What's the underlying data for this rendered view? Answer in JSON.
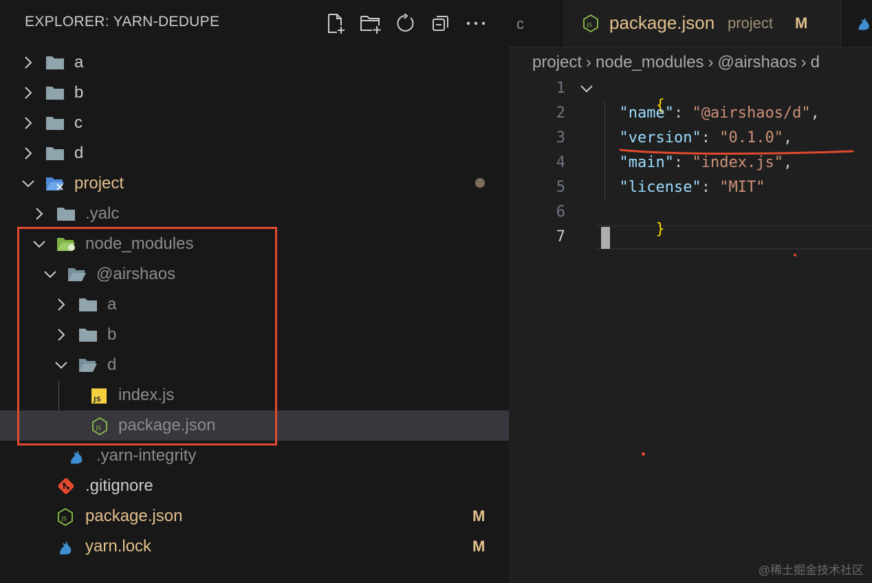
{
  "sidebar": {
    "title": "EXPLORER: YARN-DEDUPE",
    "actions": [
      {
        "icon": "new-file-icon"
      },
      {
        "icon": "new-folder-icon"
      },
      {
        "icon": "refresh-icon"
      },
      {
        "icon": "collapse-all-icon"
      },
      {
        "icon": "more-actions-icon"
      }
    ],
    "tree": {
      "a": "a",
      "b": "b",
      "c": "c",
      "d": "d",
      "project": "project",
      "yalc": ".yalc",
      "node_modules": "node_modules",
      "airshaos": "@airshaos",
      "nm_a": "a",
      "nm_b": "b",
      "nm_d": "d",
      "index_js": "index.js",
      "nm_package_json": "package.json",
      "yarn_integrity": ".yarn-integrity",
      "gitignore": ".gitignore",
      "package_json": "package.json",
      "package_json_badge": "M",
      "yarn_lock": "yarn.lock",
      "yarn_lock_badge": "M"
    }
  },
  "editor": {
    "tabs": {
      "prev_partial": "c",
      "active_name": "package.json",
      "active_desc": "project",
      "active_badge": "M"
    },
    "breadcrumbs": [
      "project",
      "node_modules",
      "@airshaos",
      "d"
    ],
    "code": {
      "line_numbers": [
        "1",
        "2",
        "3",
        "4",
        "5",
        "6",
        "7"
      ],
      "brace_open": "{",
      "brace_close": "}",
      "name_key": "\"name\"",
      "name_val": "\"@airshaos/d\"",
      "version_key": "\"version\"",
      "version_val": "\"0.1.0\"",
      "main_key": "\"main\"",
      "main_val": "\"index.js\"",
      "license_key": "\"license\"",
      "license_val": "\"MIT\"",
      "colon": ": ",
      "comma": ","
    }
  },
  "colors": {
    "annotation_red": "#e24a2f",
    "modified": "#e2c08d",
    "json_key": "#9cdcfe",
    "json_string": "#ce9178"
  },
  "watermark": "@稀土掘金技术社区"
}
